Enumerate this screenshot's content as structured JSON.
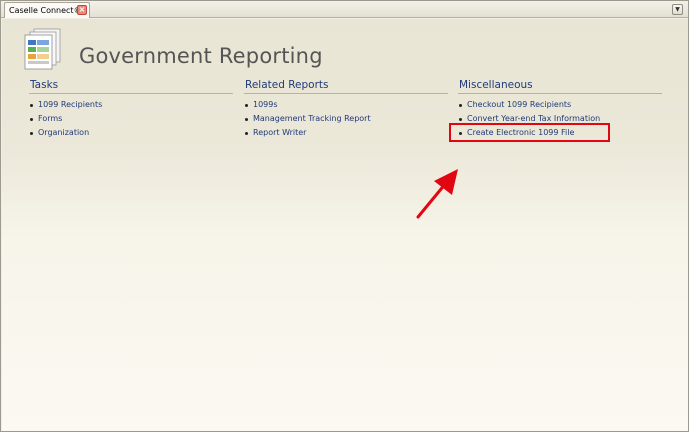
{
  "tab": {
    "label": "Caselle Connect®",
    "close_symbol": "×"
  },
  "dropdown_symbol": "▼",
  "page": {
    "title": "Government Reporting"
  },
  "sections": [
    {
      "title": "Tasks",
      "items": [
        "1099 Recipients",
        "Forms",
        "Organization"
      ]
    },
    {
      "title": "Related Reports",
      "items": [
        "1099s",
        "Management Tracking Report",
        "Report Writer"
      ]
    },
    {
      "title": "Miscellaneous",
      "items": [
        "Checkout 1099 Recipients",
        "Convert Year-end Tax Information",
        "Create Electronic 1099 File"
      ]
    }
  ],
  "colors": {
    "link": "#1f3a78",
    "title": "#555555",
    "highlight": "#e20613",
    "background": "#ece8d9"
  },
  "annotation": {
    "highlighted_item": "Create Electronic 1099 File"
  }
}
